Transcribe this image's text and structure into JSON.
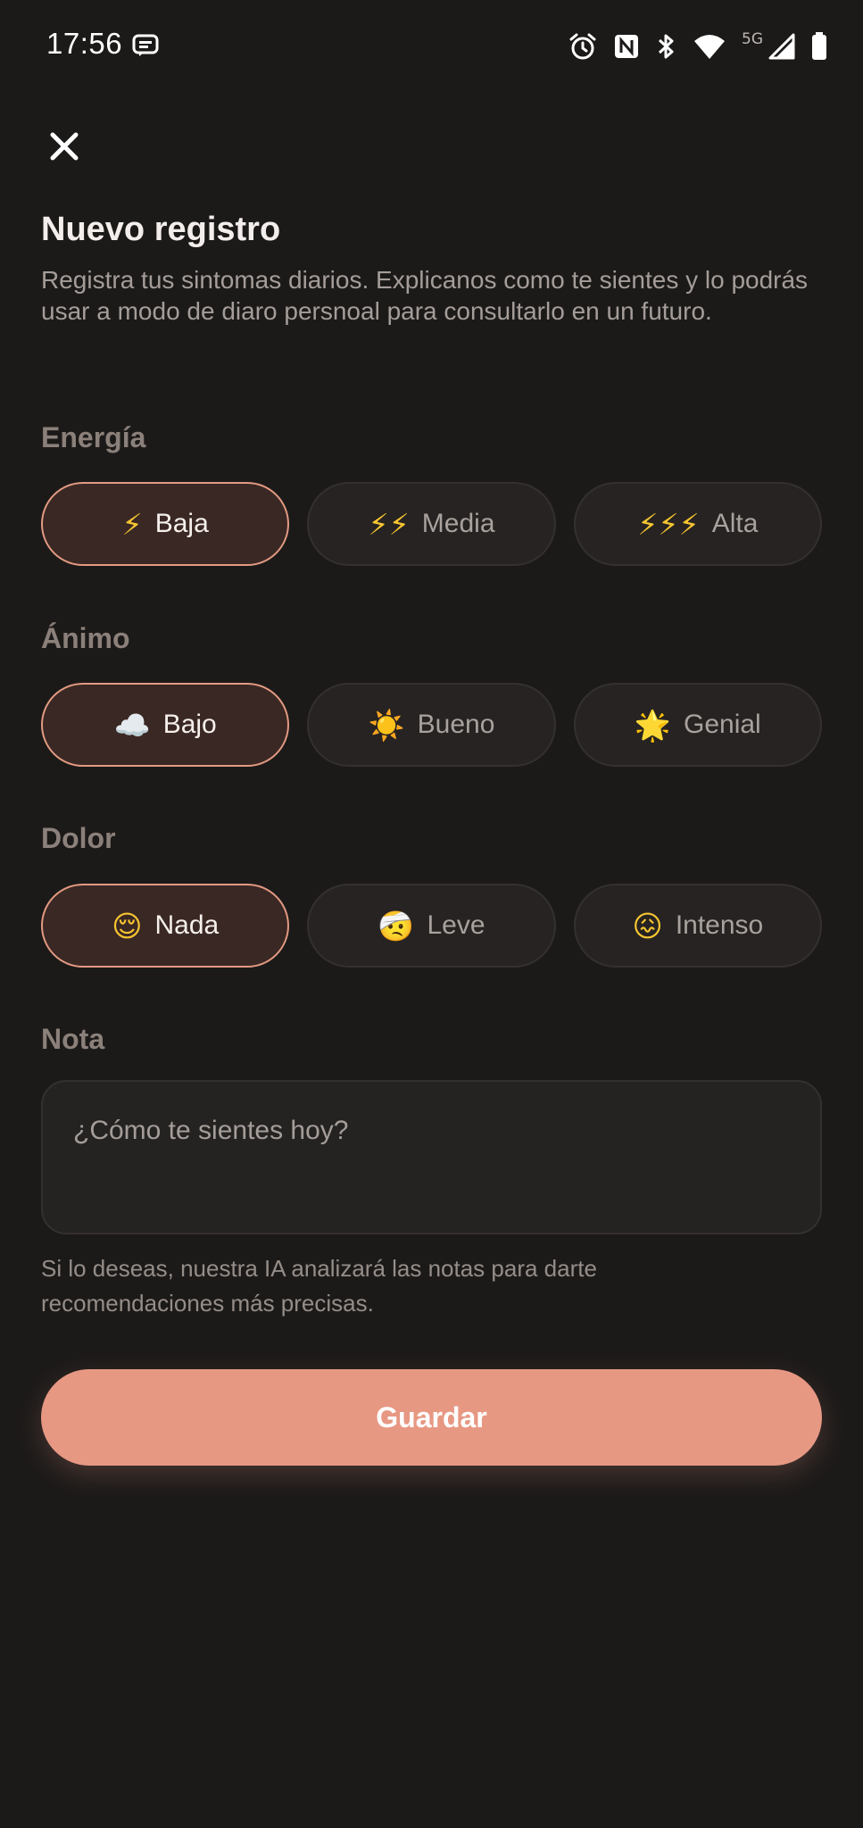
{
  "status_bar": {
    "time": "17:56",
    "network": "5G"
  },
  "header": {
    "title": "Nuevo registro",
    "subtitle": "Registra tus sintomas diarios. Explicanos como te sientes y lo podrás usar a modo de diaro persnoal para consultarlo en un futuro."
  },
  "sections": {
    "energy": {
      "label": "Energía",
      "options": [
        {
          "emoji": "⚡",
          "label": "Baja",
          "selected": true
        },
        {
          "emoji": "⚡⚡",
          "label": "Media",
          "selected": false
        },
        {
          "emoji": "⚡⚡⚡",
          "label": "Alta",
          "selected": false
        }
      ]
    },
    "mood": {
      "label": "Ánimo",
      "options": [
        {
          "emoji": "☁️",
          "label": "Bajo",
          "selected": true
        },
        {
          "emoji": "☀️",
          "label": "Bueno",
          "selected": false
        },
        {
          "emoji": "🌟",
          "label": "Genial",
          "selected": false
        }
      ]
    },
    "pain": {
      "label": "Dolor",
      "options": [
        {
          "emoji": "😌",
          "label": "Nada",
          "selected": true
        },
        {
          "emoji": "🤕",
          "label": "Leve",
          "selected": false
        },
        {
          "emoji": "😖",
          "label": "Intenso",
          "selected": false
        }
      ]
    },
    "note": {
      "label": "Nota",
      "placeholder": "¿Cómo te sientes hoy?",
      "value": "",
      "helper": "Si lo deseas, nuestra IA analizará las notas para darte recomendaciones más precisas."
    }
  },
  "actions": {
    "save_label": "Guardar"
  },
  "colors": {
    "background": "#1c1a19",
    "accent": "#e79883",
    "selected_bg": "#3a2824",
    "chip_bg": "#262322"
  },
  "icons": {
    "close": "close-icon",
    "status": [
      "message-icon",
      "alarm-icon",
      "nfc-icon",
      "bluetooth-icon",
      "wifi-icon",
      "signal-icon",
      "battery-icon"
    ]
  }
}
